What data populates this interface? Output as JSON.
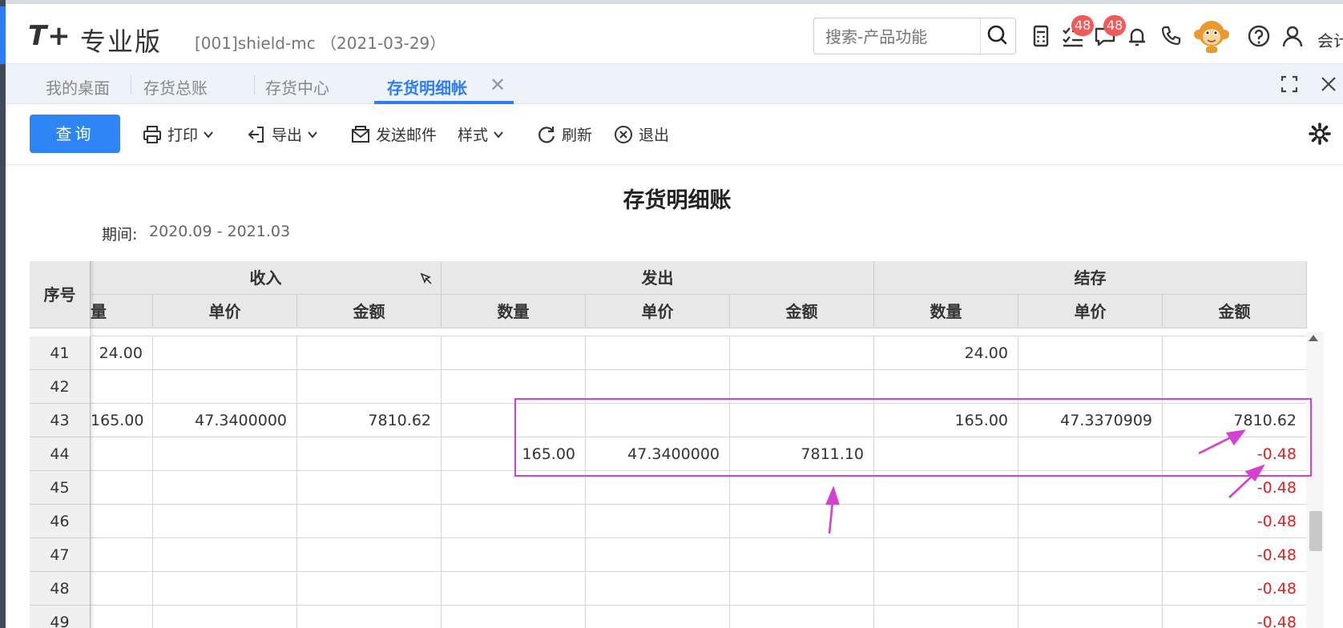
{
  "app": {
    "logo": "T+",
    "logo_sub": "专业版",
    "account": "[001]shield-mc （2021-03-29）",
    "search_placeholder": "搜索-产品功能",
    "badges": {
      "tasks": "48",
      "messages": "48"
    },
    "role": "会计"
  },
  "tabs": [
    {
      "label": "我的桌面"
    },
    {
      "label": "存货总账"
    },
    {
      "label": "存货中心"
    },
    {
      "label": "存货明细帐",
      "active": true
    }
  ],
  "toolbar": {
    "query": "查询",
    "print": "打印",
    "export": "导出",
    "email": "发送邮件",
    "style": "样式",
    "refresh": "刷新",
    "exit": "退出"
  },
  "report": {
    "title": "存货明细账",
    "period_label": "期间:",
    "period_value": "2020.09 - 2021.03"
  },
  "table": {
    "seq_header": "序号",
    "groups": [
      "收入",
      "发出",
      "结存"
    ],
    "partial_first_col": "量",
    "sub_headers": [
      "单价",
      "金额",
      "数量",
      "单价",
      "金额",
      "数量",
      "单价",
      "金额"
    ],
    "rows": [
      {
        "seq": "41",
        "cells": [
          "24.00",
          "",
          "",
          "",
          "",
          "",
          "24.00",
          "",
          ""
        ]
      },
      {
        "seq": "42",
        "cells": [
          "",
          "",
          "",
          "",
          "",
          "",
          "",
          "",
          ""
        ]
      },
      {
        "seq": "43",
        "cells": [
          "165.00",
          "47.3400000",
          "7810.62",
          "",
          "",
          "",
          "165.00",
          "47.3370909",
          "7810.62"
        ]
      },
      {
        "seq": "44",
        "cells": [
          "",
          "",
          "",
          "165.00",
          "47.3400000",
          "7811.10",
          "",
          "",
          "-0.48"
        ]
      },
      {
        "seq": "45",
        "cells": [
          "",
          "",
          "",
          "",
          "",
          "",
          "",
          "",
          "-0.48"
        ]
      },
      {
        "seq": "46",
        "cells": [
          "",
          "",
          "",
          "",
          "",
          "",
          "",
          "",
          "-0.48"
        ]
      },
      {
        "seq": "47",
        "cells": [
          "",
          "",
          "",
          "",
          "",
          "",
          "",
          "",
          "-0.48"
        ]
      },
      {
        "seq": "48",
        "cells": [
          "",
          "",
          "",
          "",
          "",
          "",
          "",
          "",
          "-0.48"
        ]
      },
      {
        "seq": "49",
        "cells": [
          "",
          "",
          "",
          "",
          "",
          "",
          "",
          "",
          "-0.48"
        ]
      }
    ]
  },
  "colors": {
    "accent": "#2e7df7",
    "negative": "#e41e1e",
    "annotation": "#d63fd0",
    "badge": "#f25a5a"
  },
  "icons": [
    "search-icon",
    "calculator-icon",
    "task-list-icon",
    "message-icon",
    "bell-icon",
    "phone-icon",
    "help-icon",
    "user-icon",
    "fullscreen-icon",
    "close-icon",
    "print-icon",
    "export-icon",
    "email-icon",
    "refresh-icon",
    "exit-icon",
    "settings-icon",
    "pin-icon"
  ]
}
